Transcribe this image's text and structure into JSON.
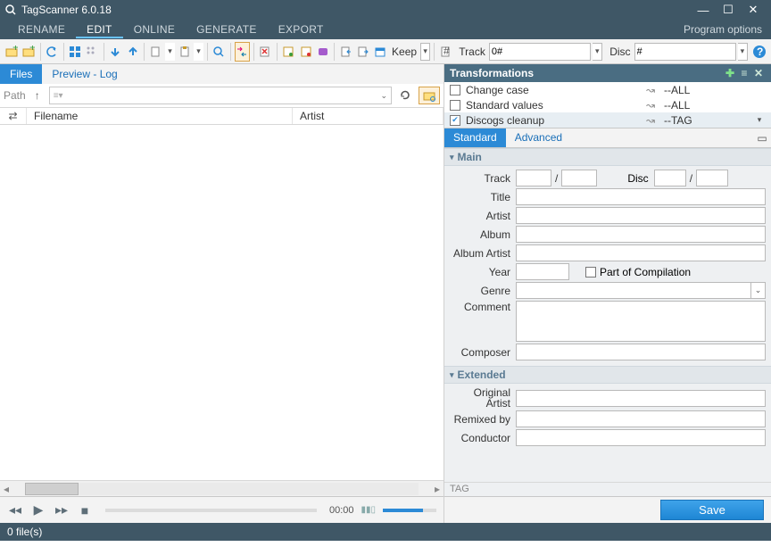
{
  "title": "TagScanner 6.0.18",
  "window_buttons": {
    "min": "—",
    "max": "☐",
    "close": "✕"
  },
  "menu": {
    "items": [
      "RENAME",
      "EDIT",
      "ONLINE",
      "GENERATE",
      "EXPORT"
    ],
    "active": 1,
    "program_options": "Program options"
  },
  "toolbar": {
    "keep_label": "Keep",
    "track_label": "Track",
    "track_value": "0#",
    "disc_label": "Disc",
    "disc_value": "#"
  },
  "left": {
    "tabs": {
      "files": "Files",
      "preview": "Preview - Log",
      "active": 0
    },
    "path_label": "Path",
    "columns": {
      "filename": "Filename",
      "artist": "Artist"
    }
  },
  "transformations": {
    "header": "Transformations",
    "rows": [
      {
        "checked": false,
        "name": "Change case",
        "target": "--ALL"
      },
      {
        "checked": false,
        "name": "Standard values",
        "target": "--ALL"
      },
      {
        "checked": true,
        "name": "Discogs cleanup",
        "target": "--TAG"
      }
    ]
  },
  "tag_panel": {
    "tabs": {
      "standard": "Standard",
      "advanced": "Advanced",
      "active": 0
    },
    "sections": {
      "main": "Main",
      "extended": "Extended"
    },
    "labels": {
      "track": "Track",
      "disc": "Disc",
      "title": "Title",
      "artist": "Artist",
      "album": "Album",
      "album_artist": "Album Artist",
      "year": "Year",
      "part_of_compilation": "Part of Compilation",
      "genre": "Genre",
      "comment": "Comment",
      "composer": "Composer",
      "original_artist": "Original Artist",
      "remixed_by": "Remixed by",
      "conductor": "Conductor"
    },
    "tagline": "TAG"
  },
  "player": {
    "time": "00:00",
    "save": "Save"
  },
  "status": "0 file(s)"
}
